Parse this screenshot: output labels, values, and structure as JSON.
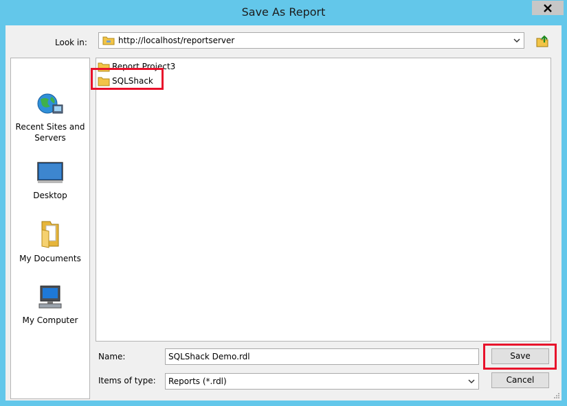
{
  "window": {
    "title": "Save As Report"
  },
  "lookin": {
    "label": "Look in:",
    "value": "http://localhost/reportserver"
  },
  "places": [
    {
      "name": "recent-sites",
      "label": "Recent Sites and Servers"
    },
    {
      "name": "desktop",
      "label": "Desktop"
    },
    {
      "name": "my-documents",
      "label": "My Documents"
    },
    {
      "name": "my-computer",
      "label": "My Computer"
    }
  ],
  "files": [
    {
      "name": "Report Project3",
      "icon": "folder-icon"
    },
    {
      "name": "SQLShack",
      "icon": "folder-icon",
      "highlighted": true
    }
  ],
  "form": {
    "name_label": "Name:",
    "name_value": "SQLShack Demo.rdl",
    "type_label": "Items of type:",
    "type_value": "Reports (*.rdl)"
  },
  "buttons": {
    "save": "Save",
    "cancel": "Cancel"
  },
  "colors": {
    "titlebar": "#63c7ea",
    "highlight": "#e8112b",
    "folder": "#f2c447"
  }
}
